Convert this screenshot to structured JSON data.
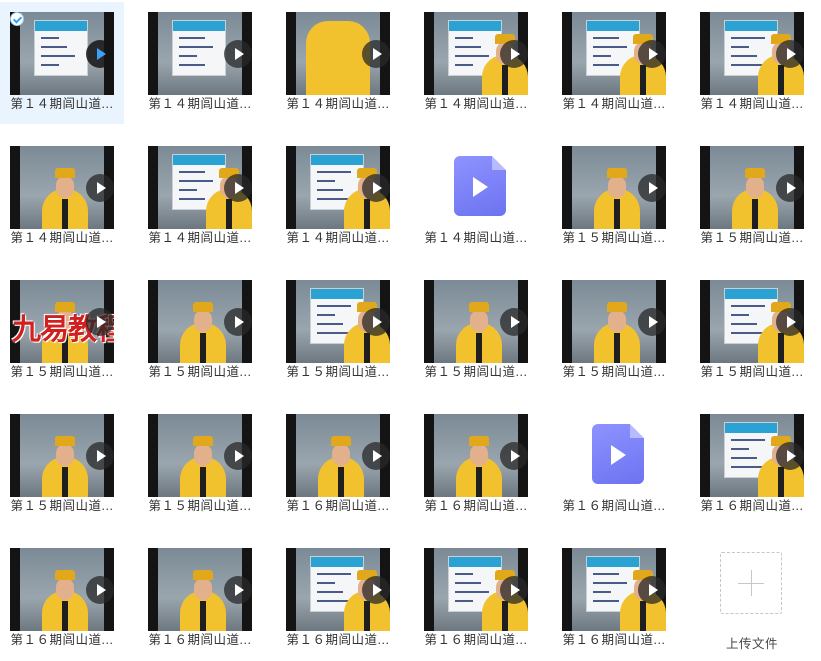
{
  "files": [
    {
      "name": "第１４期闾山道...",
      "kind": "video",
      "selected": true,
      "scene": "board",
      "badge": "check"
    },
    {
      "name": "第１４期闾山道...",
      "kind": "video",
      "scene": "board"
    },
    {
      "name": "第１４期闾山道...",
      "kind": "video",
      "scene": "robe-close"
    },
    {
      "name": "第１４期闾山道...",
      "kind": "video",
      "scene": "board-person"
    },
    {
      "name": "第１４期闾山道...",
      "kind": "video",
      "scene": "board-person"
    },
    {
      "name": "第１４期闾山道...",
      "kind": "video",
      "scene": "board-person"
    },
    {
      "name": "第１４期闾山道...",
      "kind": "video",
      "scene": "person"
    },
    {
      "name": "第１４期闾山道...",
      "kind": "video",
      "scene": "board-person"
    },
    {
      "name": "第１４期闾山道...",
      "kind": "video",
      "scene": "board-person"
    },
    {
      "name": "第１４期闾山道...",
      "kind": "file-icon"
    },
    {
      "name": "第１５期闾山道...",
      "kind": "video",
      "scene": "person"
    },
    {
      "name": "第１５期闾山道...",
      "kind": "video",
      "scene": "person"
    },
    {
      "name": "第１５期闾山道...",
      "kind": "video",
      "scene": "person",
      "watermark": "九易教程"
    },
    {
      "name": "第１５期闾山道...",
      "kind": "video",
      "scene": "person"
    },
    {
      "name": "第１５期闾山道...",
      "kind": "video",
      "scene": "board-person"
    },
    {
      "name": "第１５期闾山道...",
      "kind": "video",
      "scene": "person"
    },
    {
      "name": "第１５期闾山道...",
      "kind": "video",
      "scene": "person"
    },
    {
      "name": "第１５期闾山道...",
      "kind": "video",
      "scene": "board-person"
    },
    {
      "name": "第１５期闾山道...",
      "kind": "video",
      "scene": "person"
    },
    {
      "name": "第１５期闾山道...",
      "kind": "video",
      "scene": "person"
    },
    {
      "name": "第１６期闾山道...",
      "kind": "video",
      "scene": "person"
    },
    {
      "name": "第１６期闾山道...",
      "kind": "video",
      "scene": "person"
    },
    {
      "name": "第１６期闾山道...",
      "kind": "file-icon"
    },
    {
      "name": "第１６期闾山道...",
      "kind": "video",
      "scene": "board-person"
    },
    {
      "name": "第１６期闾山道...",
      "kind": "video",
      "scene": "person"
    },
    {
      "name": "第１６期闾山道...",
      "kind": "video",
      "scene": "person"
    },
    {
      "name": "第１６期闾山道...",
      "kind": "video",
      "scene": "board-person"
    },
    {
      "name": "第１６期闾山道...",
      "kind": "video",
      "scene": "board-person"
    },
    {
      "name": "第１６期闾山道...",
      "kind": "video",
      "scene": "board-person"
    },
    {
      "name": "上传文件",
      "kind": "upload"
    }
  ]
}
